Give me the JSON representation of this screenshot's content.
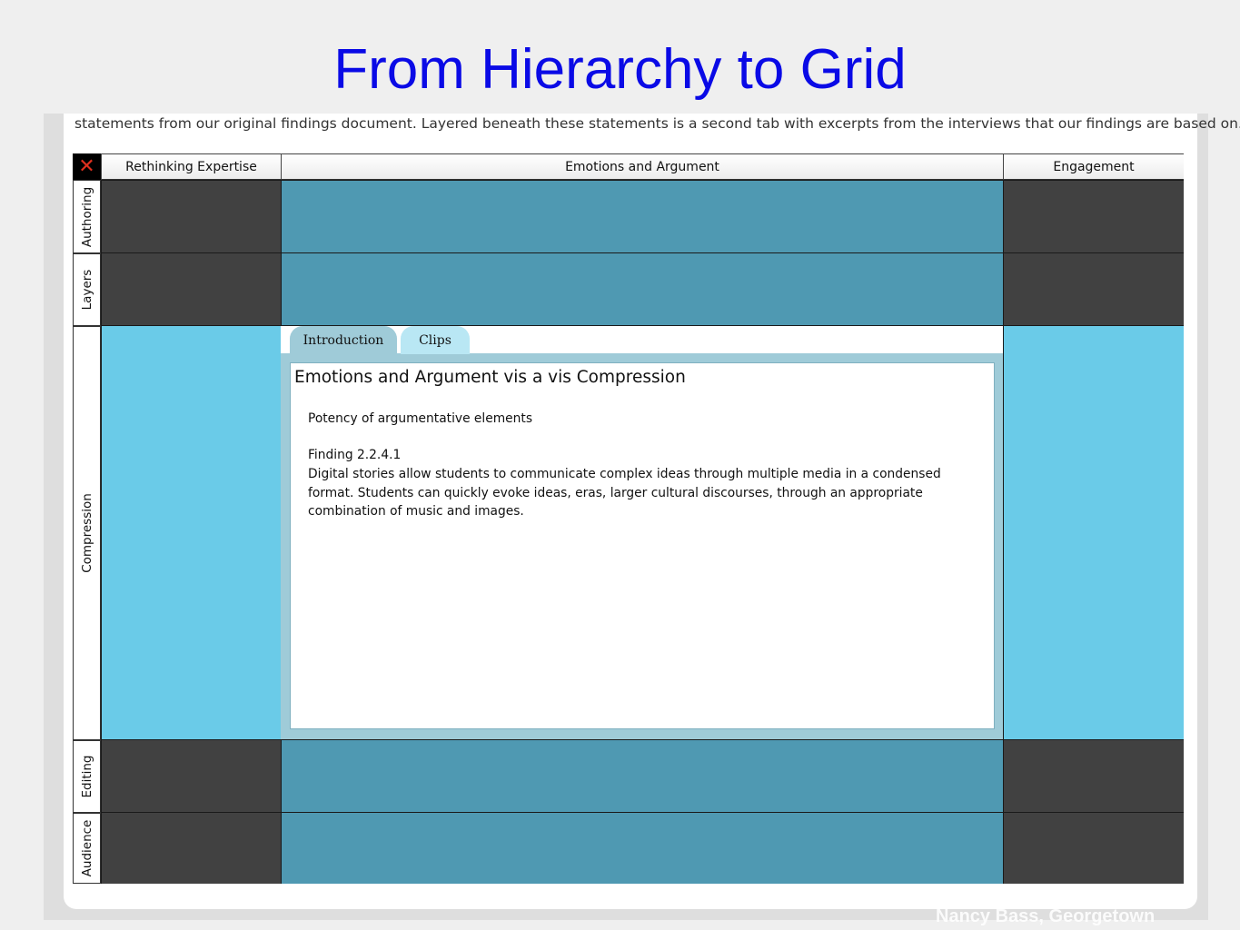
{
  "slide": {
    "title": "From Hierarchy to Grid",
    "credit": "Nancy Bass, Georgetown"
  },
  "screenshot": {
    "intro_text": "statements from our original findings document. Layered beneath these statements is a second tab with excerpts from the interviews that our findings are based on.",
    "grid": {
      "close_glyph": "✕",
      "columns": [
        "Rethinking Expertise",
        "Emotions and Argument",
        "Engagement"
      ],
      "rows": [
        "Authoring",
        "Layers",
        "Compression",
        "Editing",
        "Audience"
      ]
    },
    "panel": {
      "tabs": [
        "Introduction",
        "Clips"
      ],
      "active_tab": "Introduction",
      "heading": "Emotions and Argument vis a vis Compression",
      "subheading": "Potency of argumentative elements",
      "finding_id": "Finding 2.2.4.1",
      "finding_text": "Digital stories allow students to communicate complex ideas through multiple media in a condensed format. Students can quickly evoke ideas, eras, larger cultural discourses, through an appropriate combination of music and images."
    }
  },
  "colors": {
    "title": "#0a0ae6",
    "dark_cell": "#414141",
    "teal_cell": "#4f99b2",
    "light_cell": "#6acbe8",
    "tab_active": "#9fcbd8",
    "tab_inactive": "#b9e7f4",
    "close_icon": "#e0301e"
  }
}
